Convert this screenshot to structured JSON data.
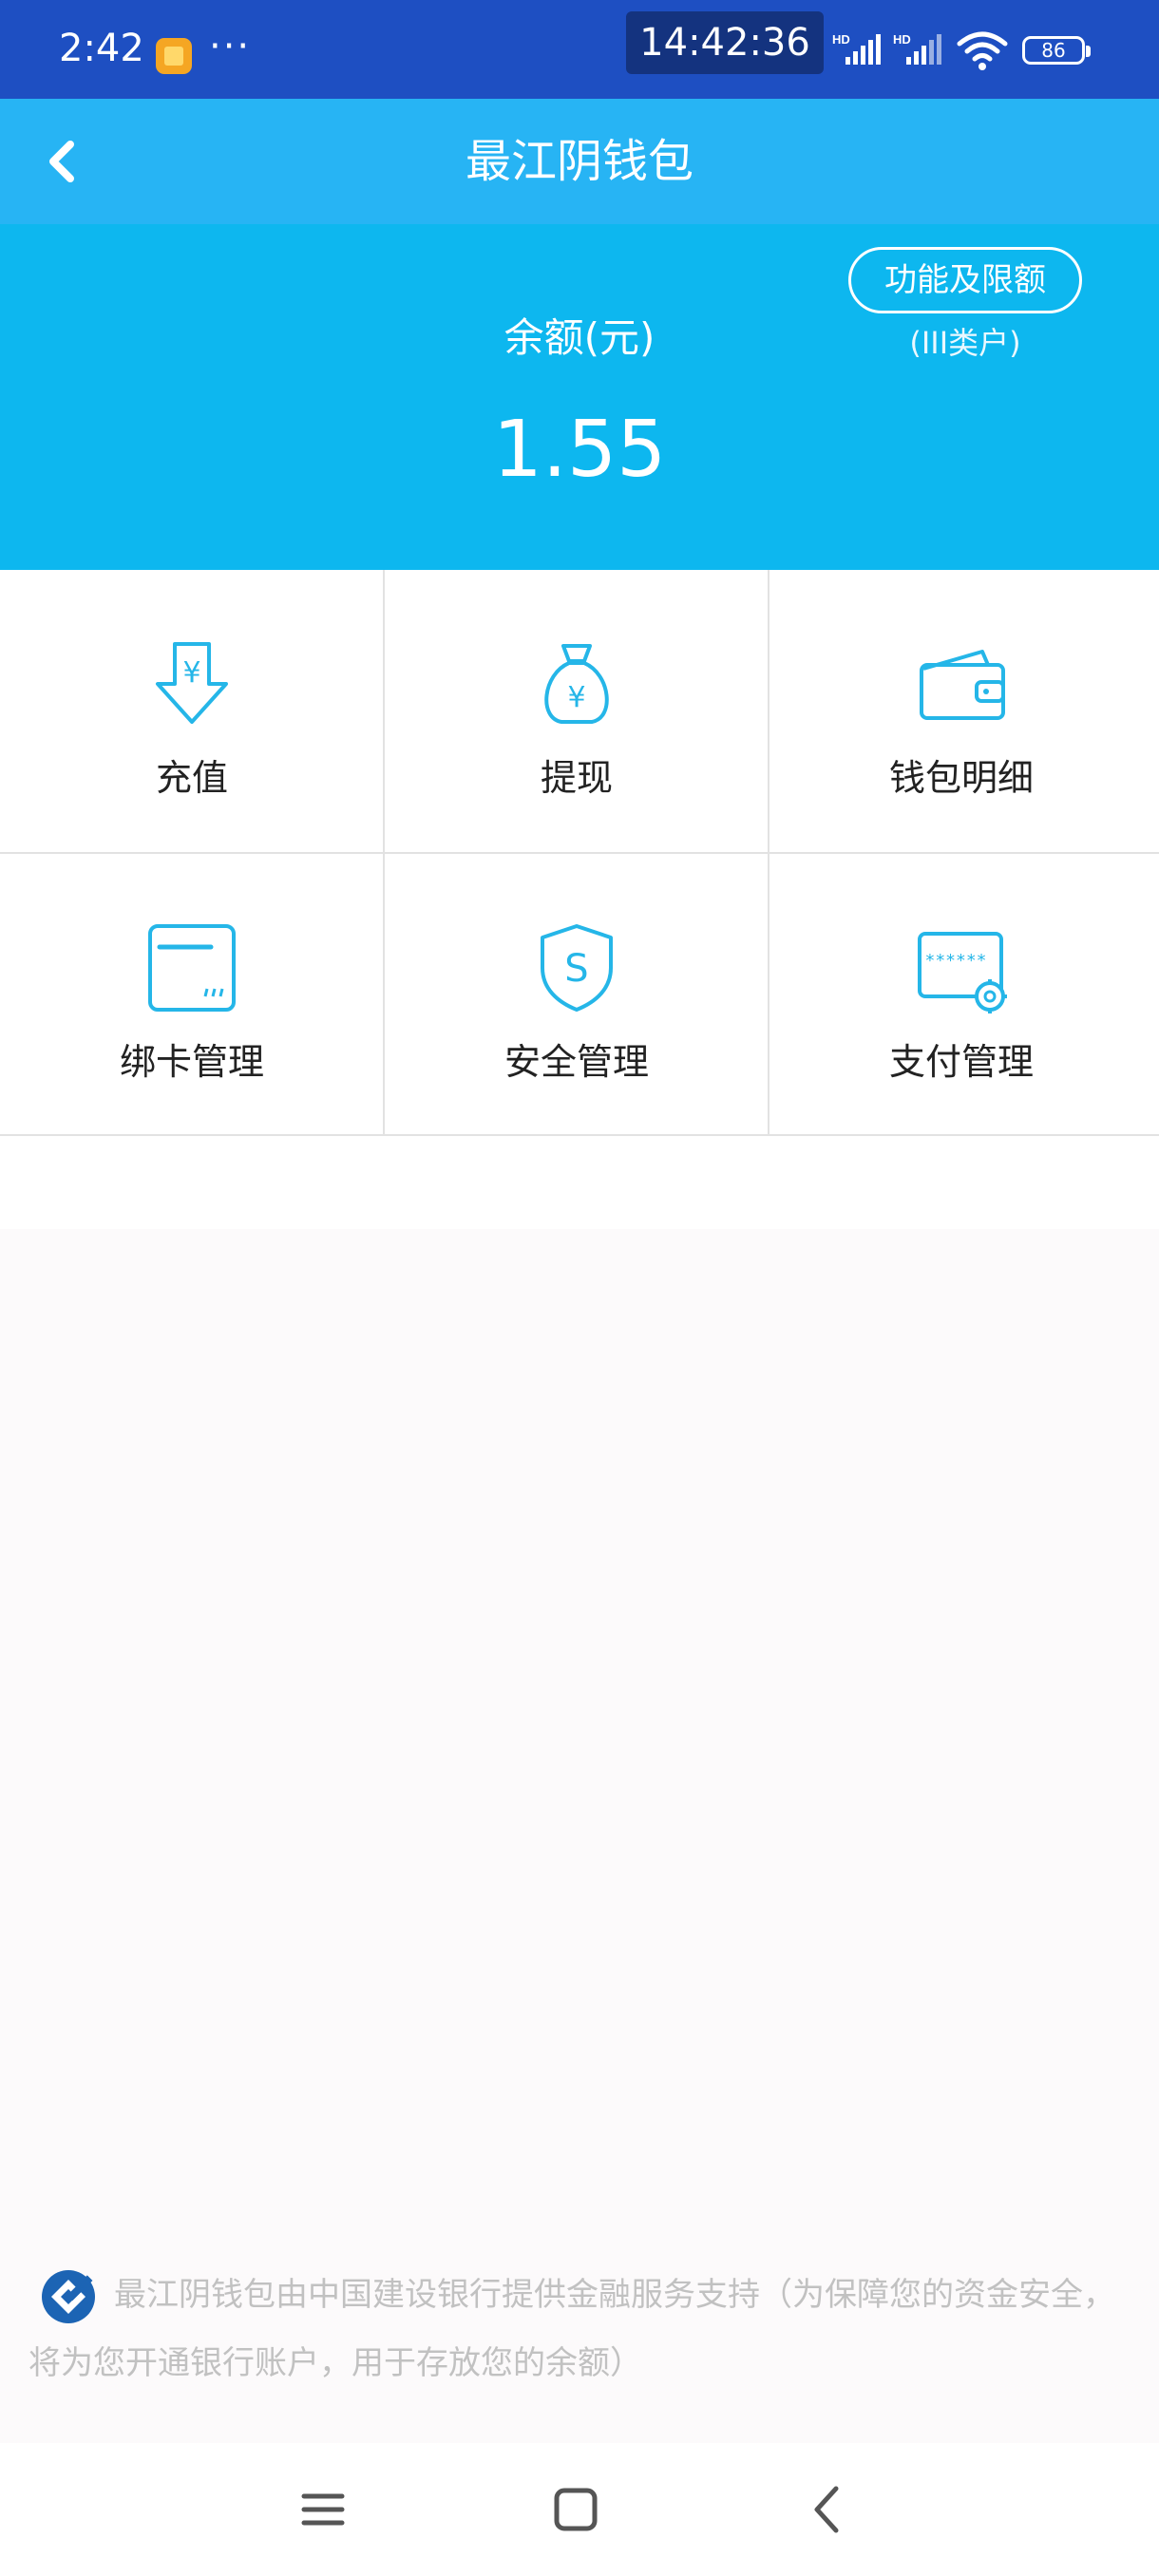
{
  "status_bar": {
    "time": "2:42",
    "more": "···",
    "clock": "14:42:36",
    "signal1_label": "HD",
    "signal2_label": "HD",
    "battery": "86"
  },
  "nav": {
    "title": "最江阴钱包"
  },
  "balance": {
    "label": "余额(元)",
    "amount": "1.55",
    "limits_button": "功能及限额",
    "account_class": "(III类户)"
  },
  "actions": [
    {
      "label": "充值",
      "icon": "recharge-icon"
    },
    {
      "label": "提现",
      "icon": "money-bag-icon"
    },
    {
      "label": "钱包明细",
      "icon": "wallet-icon"
    },
    {
      "label": "绑卡管理",
      "icon": "card-icon"
    },
    {
      "label": "安全管理",
      "icon": "shield-icon"
    },
    {
      "label": "支付管理",
      "icon": "payment-settings-icon"
    }
  ],
  "footer": {
    "note": "最江阴钱包由中国建设银行提供金融服务支持（为保障您的资金安全，将为您开通银行账户，用于存放您的余额）"
  },
  "colors": {
    "status_bar": "#1e4fc2",
    "nav_bar": "#27b4f4",
    "balance_panel": "#0db7ef",
    "icon_accent": "#25b6e8"
  }
}
